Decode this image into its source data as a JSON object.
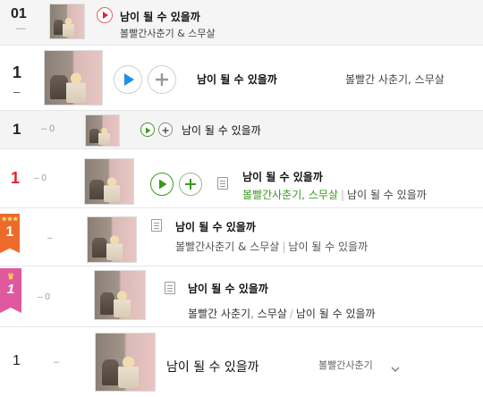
{
  "colors": {
    "play_blue": "#1f8fe8",
    "play_green": "#3a9a1e",
    "rank_red": "#e0242b",
    "badge_orange": "#ee6a2a",
    "badge_pink": "#e0589e"
  },
  "rows": [
    {
      "rank": "01",
      "change": "—",
      "title": "남이 될 수 있을까",
      "artist": "볼빨간사춘기 & 스무살",
      "icons": [
        "play-icon"
      ]
    },
    {
      "rank": "1",
      "change": "–",
      "title": "남이 될 수 있을까",
      "artist": "볼빨간 사춘기, 스무살",
      "icons": [
        "play-icon",
        "add-icon"
      ]
    },
    {
      "rank": "1",
      "change": "– 0",
      "title": "남이 될 수 있을까",
      "icons": [
        "play-icon",
        "add-icon"
      ]
    },
    {
      "rank": "1",
      "change": "– 0",
      "title": "남이 될 수 있을까",
      "artist": "볼빨간사춘기, 스무살",
      "album": "남이 될 수 있을까",
      "icons": [
        "play-icon",
        "add-icon",
        "lyrics-icon"
      ]
    },
    {
      "rank": "1",
      "change": "–",
      "title": "남이 될 수 있을까",
      "artist": "볼빨간사춘기 & 스무살",
      "album": "남이 될 수 있을까",
      "badge_icon": "three-stars-icon",
      "icons": [
        "lyrics-icon"
      ]
    },
    {
      "rank": "1",
      "change": "– 0",
      "title": "남이 될 수 있을까",
      "artist_1": "볼빨간 사춘기",
      "artist_2": "스무살",
      "album": "남이 될 수 있을까",
      "badge_icon": "crown-icon",
      "icons": [
        "lyrics-icon"
      ]
    },
    {
      "rank": "1",
      "change": "–",
      "title": "남이 될 수 있을까",
      "artist": "볼빨간사춘기",
      "icons": [
        "chevron-down-icon"
      ]
    }
  ]
}
